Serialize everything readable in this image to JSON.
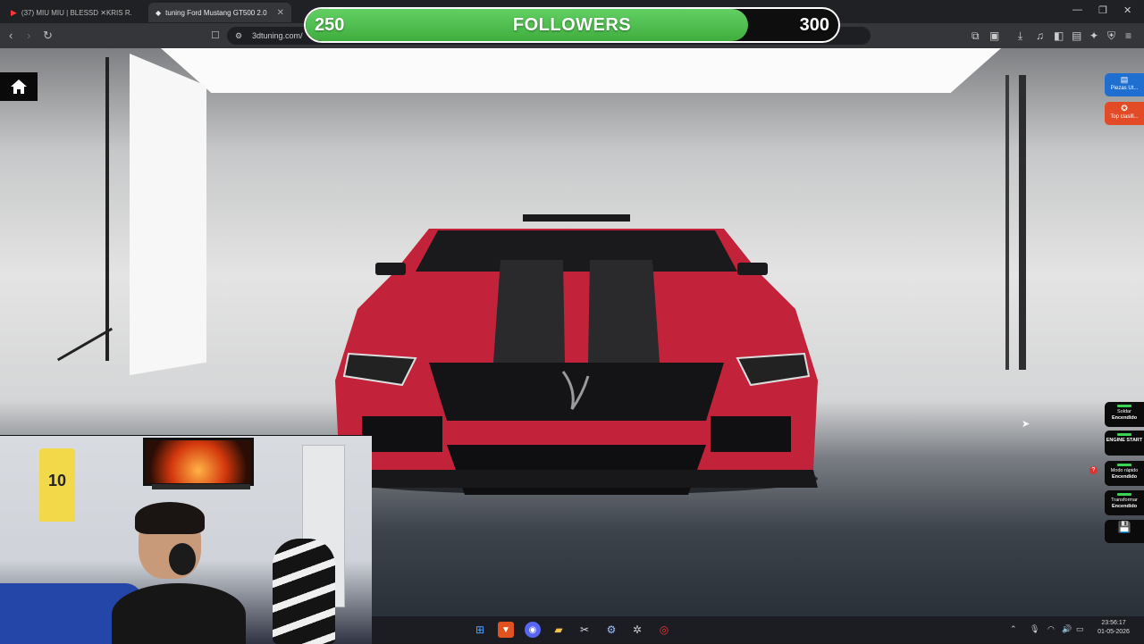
{
  "browser": {
    "tabs": [
      {
        "label": "(37) MIU MIU | BLESSD ✕KRIS R.",
        "active": false
      },
      {
        "label": "tuning Ford Mustang GT500 2.0",
        "active": true
      }
    ],
    "url": "3dtuning.com/"
  },
  "followers": {
    "current": "250",
    "label": "FOLLOWERS",
    "goal": "300",
    "progress": 0.83
  },
  "app": {
    "side_buttons": [
      {
        "label": "Piezas Ut...",
        "color": "#1e6fd0"
      },
      {
        "label": "Top clasifi...",
        "color": "#e24b26"
      }
    ],
    "toggles": [
      {
        "label": "Soldar",
        "state": "Encendido"
      },
      {
        "label": "ENGINE START",
        "state": ""
      },
      {
        "label": "Modo rápido",
        "state": "Encendido"
      },
      {
        "label": "Transformar",
        "state": "Encendido"
      }
    ],
    "car": {
      "body_color": "#c3233a",
      "stripe_color": "#2a2a2c"
    }
  },
  "webcam": {
    "jersey_number": "10"
  },
  "taskbar": {
    "clock_time": "23:56:17",
    "clock_date": "01-05-2026"
  },
  "colors": {
    "accent_green": "#4cbf4c",
    "chrome_dark": "#202124"
  }
}
